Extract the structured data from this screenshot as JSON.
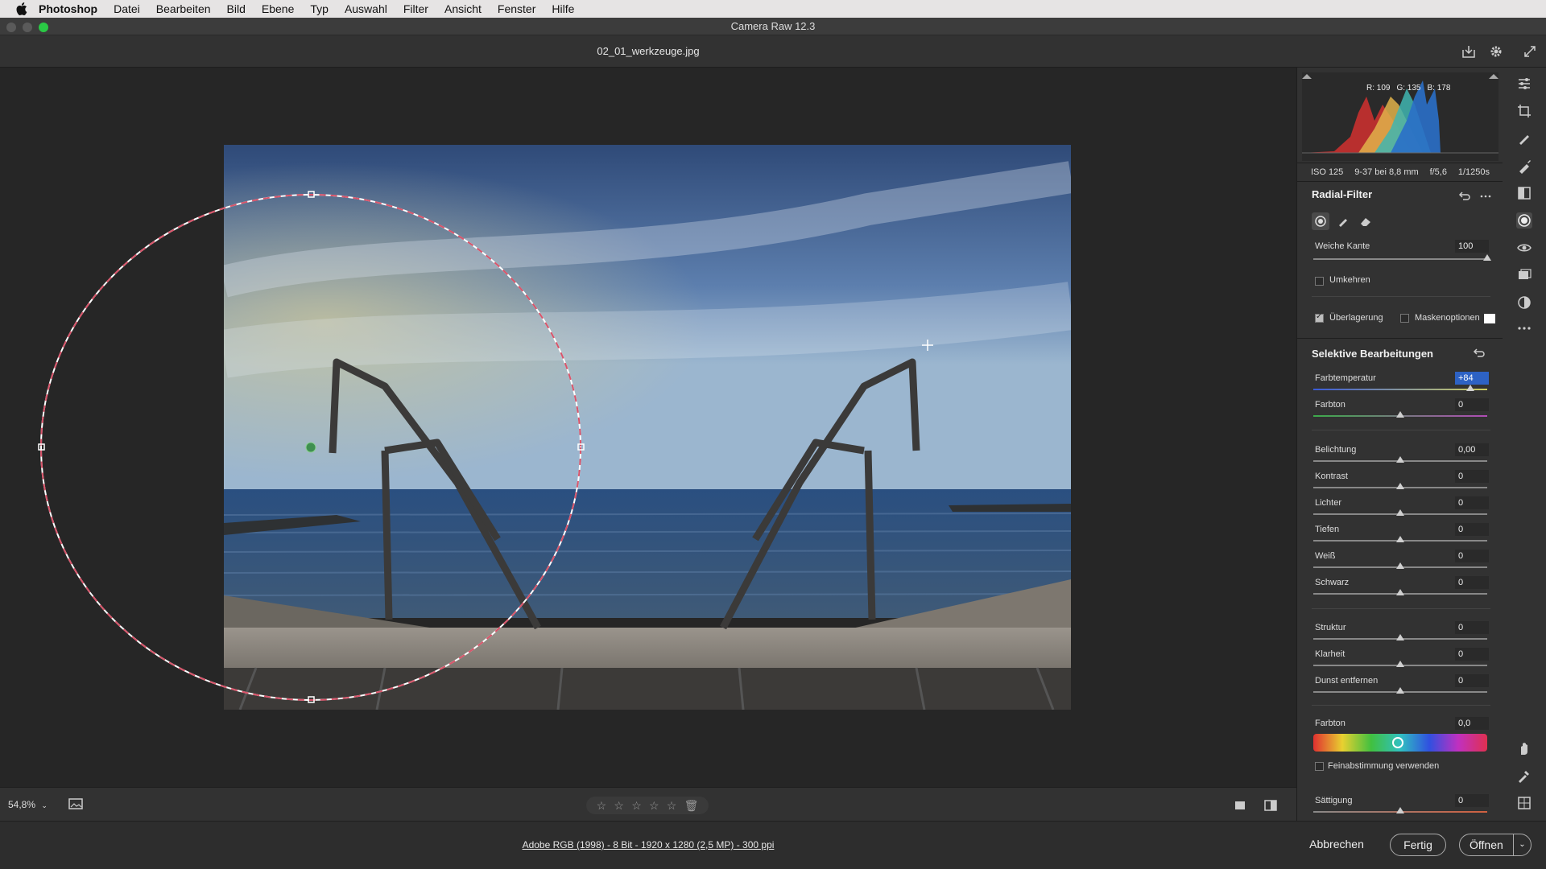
{
  "menubar": {
    "app": "Photoshop",
    "items": [
      "Datei",
      "Bearbeiten",
      "Bild",
      "Ebene",
      "Typ",
      "Auswahl",
      "Filter",
      "Ansicht",
      "Fenster",
      "Hilfe"
    ]
  },
  "window": {
    "title": "Camera Raw 12.3"
  },
  "file": {
    "name": "02_01_werkzeuge.jpg"
  },
  "histogram": {
    "r": "R: 109",
    "g": "G: 135",
    "b": "B: 178"
  },
  "camera_info": {
    "iso": "ISO 125",
    "lens": "9-37 bei 8,8 mm",
    "aperture": "f/5,6",
    "shutter": "1/1250s"
  },
  "radial_filter": {
    "title": "Radial-Filter",
    "feather_label": "Weiche Kante",
    "feather_value": "100",
    "invert_label": "Umkehren",
    "overlay_label": "Überlagerung",
    "mask_options_label": "Maskenoptionen"
  },
  "selective": {
    "title": "Selektive Bearbeitungen",
    "temp_label": "Farbtemperatur",
    "temp_value": "+84",
    "tint_label": "Farbton",
    "tint_value": "0",
    "rows": [
      {
        "label": "Belichtung",
        "value": "0,00"
      },
      {
        "label": "Kontrast",
        "value": "0"
      },
      {
        "label": "Lichter",
        "value": "0"
      },
      {
        "label": "Tiefen",
        "value": "0"
      },
      {
        "label": "Weiß",
        "value": "0"
      },
      {
        "label": "Schwarz",
        "value": "0"
      }
    ],
    "rows2": [
      {
        "label": "Struktur",
        "value": "0"
      },
      {
        "label": "Klarheit",
        "value": "0"
      },
      {
        "label": "Dunst entfernen",
        "value": "0"
      }
    ],
    "hue_label": "Farbton",
    "hue_value": "0,0",
    "fine_tune_label": "Feinabstimmung verwenden",
    "saturation_label": "Sättigung",
    "saturation_value": "0"
  },
  "canvas_toolbar": {
    "zoom": "54,8%"
  },
  "footer": {
    "workflow": "Adobe RGB (1998) - 8 Bit - 1920 x 1280 (2,5 MP) - 300 ppi",
    "cancel": "Abbrechen",
    "done": "Fertig",
    "open": "Öffnen"
  },
  "colors": {
    "accent": "#2d62c4",
    "mask_outline": "#d9546a",
    "zoom_button": "#2ac845"
  }
}
